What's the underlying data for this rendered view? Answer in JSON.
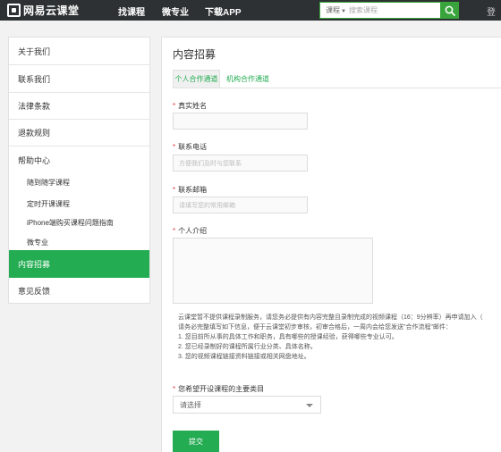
{
  "topbar": {
    "logo_text": "网易云课堂",
    "nav": [
      "找课程",
      "微专业",
      "下载APP"
    ],
    "search_type": "课程",
    "search_placeholder": "搜索课程",
    "right_text": "登"
  },
  "sidebar": {
    "items": [
      {
        "label": "关于我们"
      },
      {
        "label": "联系我们"
      },
      {
        "label": "法律条款"
      },
      {
        "label": "退款规则"
      },
      {
        "label": "帮助中心"
      }
    ],
    "help_sub": [
      "随到随学课程",
      "定时开课课程",
      "iPhone端购买课程问题指南",
      "微专业"
    ],
    "active_label": "内容招募",
    "last_label": "意见反馈"
  },
  "main": {
    "title": "内容招募",
    "tabs": [
      "个人合作通道",
      "机构合作通道"
    ],
    "fields": {
      "name_label": "真实姓名",
      "phone_label": "联系电话",
      "phone_placeholder": "方便我们及时与您联系",
      "email_label": "联系邮箱",
      "email_placeholder": "请填写您的常用邮箱",
      "intro_label": "个人介绍",
      "category_label": "您希望开设课程的主要类目",
      "category_select": "请选择"
    },
    "notice": [
      "云课堂暂不提供课程录制服务，请您务必提供有内容完整且录制完成的视频课程（16：9分辨率）再申请加入（",
      "请务必完整填写如下信息，便于云课堂初步审核，初审合格后，一周内会给您发送\"合作流程\"邮件：",
      "1. 您目前所从事的具体工作和职务，具有哪些的授课经验，获得哪些专业认可。",
      "2. 您已经录制好的课程所属行业分类、具体名称。",
      "3. 您的视频课程链接资料链接或相关网盘地址。"
    ],
    "required_mark": "*",
    "submit_label": "提交"
  },
  "colors": {
    "topbar": "#2d3133",
    "accent": "#23ac52",
    "required": "#e4393c"
  }
}
